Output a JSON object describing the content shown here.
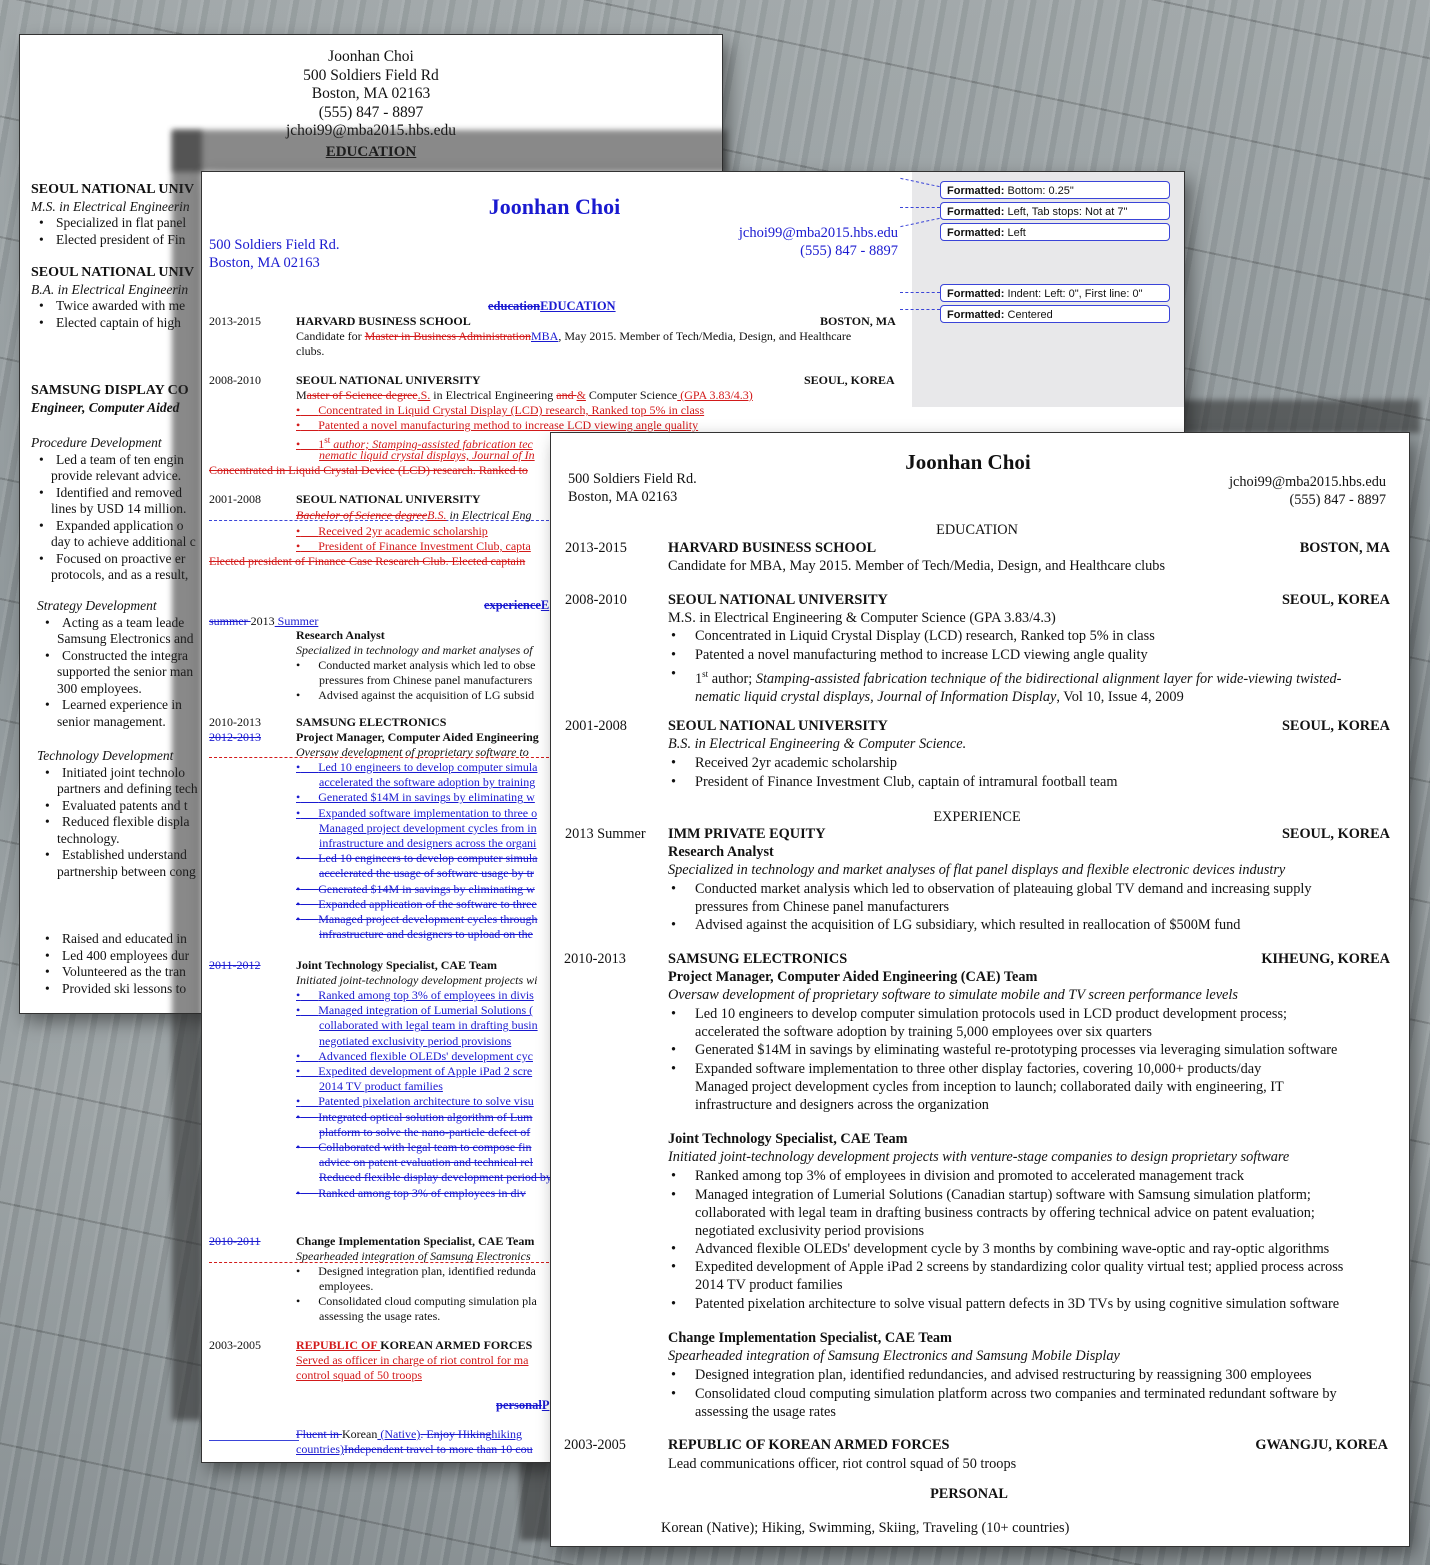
{
  "page1": {
    "header": [
      "Joonhan Choi",
      "500 Soldiers Field Rd",
      "Boston, MA 02163",
      "(555) 847 - 8897",
      "jchoi99@mba2015.hbs.edu"
    ],
    "section_education": "EDUCATION",
    "snu1_name": "SEOUL NATIONAL UNIV",
    "snu1_degree": "M.S. in Electrical Engineerin",
    "snu1_b1": "Specialized in flat panel",
    "snu1_b2": "Elected president of Fin",
    "snu2_name": "SEOUL NATIONAL UNIV",
    "snu2_degree": "B.A. in Electrical Engineerin",
    "snu2_b1": "Twice awarded with me",
    "snu2_b2": "Elected captain of high",
    "sam_name": "SAMSUNG DISPLAY CO",
    "sam_role": "Engineer, Computer Aided",
    "proc_head": "Procedure Development",
    "proc_lines": [
      "Led a team of ten engin",
      "provide relevant advice.",
      "Identified and removed",
      "lines by USD 14 million.",
      "Expanded application o",
      "day to achieve additional c",
      "Focused on proactive er",
      "protocols, and as a result,"
    ],
    "strat_head": "Strategy Development",
    "strat_lines": [
      "Acting as a team leade",
      "Samsung Electronics and",
      "Constructed the integra",
      "supported the senior man",
      "300 employees.",
      "Learned experience in",
      "senior management."
    ],
    "tech_head": "Technology Development",
    "tech_lines": [
      "Initiated joint technolo",
      "partners and defining tech",
      "Evaluated patents and t",
      "Reduced flexible displa",
      "technology.",
      "Established understand",
      "partnership between cong"
    ],
    "pers_lines": [
      "Raised and educated in",
      "Led 400 employees dur",
      "Volunteered as the tran",
      "Provided ski lessons to"
    ]
  },
  "page2": {
    "name": "Joonhan Choi",
    "addr1": "500 Soldiers Field Rd.",
    "addr2": "Boston, MA 02163",
    "email": "jchoi99@mba2015.hbs.edu",
    "phone": "(555) 847 - 8897",
    "balloons": [
      {
        "k": "Formatted:",
        "v": " Bottom:  0.25\""
      },
      {
        "k": "Formatted:",
        "v": " Left, Tab stops: Not at  7\""
      },
      {
        "k": "Formatted:",
        "v": " Left"
      },
      {
        "k": "Formatted:",
        "v": " Indent: Left:  0\", First line:  0\""
      },
      {
        "k": "Formatted:",
        "v": " Centered"
      }
    ],
    "edu_del": "education",
    "edu_ins": "EDUCATION",
    "hbs_years": "2013-2015",
    "hbs_name": "HARVARD BUSINESS SCHOOL",
    "hbs_loc": "BOSTON, MA",
    "hbs_l1a": "Candidate for ",
    "hbs_l1_del": "Master in Business Administration",
    "hbs_l1_ins": "MBA",
    "hbs_l1b": ", May 2015. Member of Tech/Media, Design, and Healthcare",
    "hbs_l2": "clubs.",
    "snu_years": "2008-2010",
    "snu_name": "SEOUL NATIONAL UNIVERSITY",
    "snu_loc": "SEOUL, KOREA",
    "snu_l1a": "M",
    "snu_l1_del1": "aster of Science degree",
    "snu_l1_ins1": ".S.",
    "snu_l1b": " in Electrical Engineering ",
    "snu_l1_del2": "and ",
    "snu_l1_ins2": "&",
    "snu_l1c": " Computer Science",
    "snu_l1_ins3": " (GPA 3.83/4.3)",
    "snu_b1": "Concentrated in Liquid Crystal Display (LCD) research, Ranked top 5% in class",
    "snu_b2": "Patented a novel manufacturing method to increase LCD viewing angle quality",
    "snu_b3a": "1",
    "snu_b3sup": "st",
    "snu_b3b": " author; Stamping-assisted fabrication tec",
    "snu_b3c": "nematic liquid crystal displays, Journal of In",
    "snu_del_line": "Concentrated in Liquid Crystal Device (LCD) research. Ranked to",
    "snu2_years": "2001-2008",
    "snu2_name": "SEOUL NATIONAL UNIVERSITY",
    "snu2_l1_del": "Bachelor of Science degree",
    "snu2_l1_ins": "B.S.",
    "snu2_l1b": " in Electrical Eng",
    "snu2_b1": "Received 2yr academic scholarship",
    "snu2_b2": "President of Finance Investment Club, capta",
    "snu2_del_line": "Elected president of Finance Case Research Club. Elected captain",
    "exp_del": "experience",
    "exp_ins": "E",
    "imm_years_del": "summer ",
    "imm_years": "2013",
    "imm_years_ins": " Summer",
    "imm_role": "Research Analyst",
    "imm_desc": "Specialized in technology and market analyses of",
    "imm_b1": "Conducted market analysis which led to obse",
    "imm_b1b": "pressures from Chinese panel manufacturers",
    "imm_b2": "Advised against the acquisition of LG subsid",
    "sam_years": "2010-2013",
    "sam_years_del": "2012-2013",
    "sam_name": "SAMSUNG ELECTRONICS",
    "sam_role": "Project Manager, Computer Aided Engineering",
    "sam_desc": "Oversaw development of proprietary software to",
    "sam_lines": [
      {
        "t": "Led 10 engineers to develop computer simula",
        "c": "blue ul",
        "b": true
      },
      {
        "t": "accelerated the software adoption by training",
        "c": "blue ul",
        "b": false
      },
      {
        "t": "Generated $14M in savings by eliminating w",
        "c": "blue ul",
        "b": true
      },
      {
        "t": "Expanded software implementation to three o",
        "c": "blue ul",
        "b": true
      },
      {
        "t": "Managed project development cycles from in",
        "c": "blue ul",
        "b": false
      },
      {
        "t": "infrastructure and designers across the organi",
        "c": "blue ul",
        "b": false
      },
      {
        "t": "Led 10 engineers to develop computer simula",
        "c": "blue st",
        "b": true
      },
      {
        "t": "accelerated the usage of software usage by tr",
        "c": "blue st",
        "b": false
      },
      {
        "t": "Generated $14M in savings by eliminating w",
        "c": "blue st",
        "b": true
      },
      {
        "t": "Expanded application of the software to three",
        "c": "blue st",
        "b": true
      },
      {
        "t": "Managed project development cycles through",
        "c": "blue st",
        "b": true
      },
      {
        "t": "infrastructure and designers to upload on the",
        "c": "blue st",
        "b": false
      }
    ],
    "jts_years_del": "2011-2012",
    "jts_role": "Joint Technology Specialist, CAE Team",
    "jts_desc": "Initiated joint-technology development projects wi",
    "jts_lines": [
      {
        "t": "Ranked among top 3% of employees in divis",
        "c": "blue ul",
        "b": true
      },
      {
        "t": "Managed integration of Lumerial Solutions (",
        "c": "blue ul",
        "b": true
      },
      {
        "t": "collaborated with legal team in drafting busin",
        "c": "blue ul",
        "b": false
      },
      {
        "t": "negotiated exclusivity period provisions",
        "c": "blue ul",
        "b": false
      },
      {
        "t": "Advanced flexible OLEDs' development cyc",
        "c": "blue ul",
        "b": true
      },
      {
        "t": "Expedited development of Apple iPad 2 scre",
        "c": "blue ul",
        "b": true
      },
      {
        "t": "2014 TV product families",
        "c": "blue ul",
        "b": false
      },
      {
        "t": "Patented pixelation architecture to solve visu",
        "c": "blue ul",
        "b": true
      },
      {
        "t": "Integrated optical solution algorithm of Lum",
        "c": "blue st",
        "b": true
      },
      {
        "t": "platform to solve the nano-particle defect of",
        "c": "blue st",
        "b": false
      },
      {
        "t": "Collaborated with legal team to compose fin",
        "c": "blue st",
        "b": true
      },
      {
        "t": "advice on patent evaluation and technical rel",
        "c": "blue st",
        "b": false
      },
      {
        "t": "Reduced flexible display development period by",
        "c": "blue st",
        "b": false
      },
      {
        "t": "Ranked among top 3% of employees in div",
        "c": "blue st",
        "b": true
      }
    ],
    "cis_years_del": "2010-2011",
    "cis_role": "Change Implementation Specialist, CAE Team",
    "cis_desc": "Spearheaded integration of Samsung Electronics",
    "cis_b1": "Designed integration plan, identified redunda",
    "cis_b1b": "employees.",
    "cis_b2": "Consolidated cloud computing simulation pla",
    "cis_b2b": "assessing the usage rates.",
    "rok_years": "2003-2005",
    "rok_ins": "REPUBLIC OF ",
    "rok_name": "KOREAN ARMED FORCES",
    "rok_l1": "Served as officer in charge of riot control for ma",
    "rok_l2": "control squad of 50 troops",
    "pers_del": "personal",
    "pers_ins": "P",
    "pers_l1_del1": "Fluent in ",
    "pers_l1a": "Korean",
    "pers_l1_ins": " (Native)",
    "pers_l1_del2": ". Enjoy ",
    "pers_l1_del3": "Hiking",
    "pers_l1_ins2": "hiking",
    "pers_l2_ins": "countries)",
    "pers_l2_del": "Independent travel to more than 10 cou"
  },
  "page3": {
    "name": "Joonhan Choi",
    "addr1": "500 Soldiers Field Rd.",
    "addr2": "Boston, MA 02163",
    "email": "jchoi99@mba2015.hbs.edu",
    "phone": "(555) 847 - 8897",
    "education": "EDUCATION",
    "hbs": {
      "years": "2013-2015",
      "name": "HARVARD BUSINESS SCHOOL",
      "loc": "BOSTON, MA",
      "l1": "Candidate for MBA, May 2015. Member of Tech/Media, Design, and Healthcare clubs"
    },
    "snu": {
      "years": "2008-2010",
      "name": "SEOUL NATIONAL UNIVERSITY",
      "loc": "SEOUL, KOREA",
      "l1": "M.S. in Electrical Engineering & Computer Science (GPA 3.83/4.3)",
      "b1": "Concentrated in Liquid Crystal Display (LCD) research, Ranked top 5% in class",
      "b2": "Patented a novel manufacturing method to increase LCD viewing angle quality",
      "b3a": "1",
      "b3sup": "st",
      "b3b": " author; ",
      "b3i": "Stamping-assisted fabrication technique of the bidirectional alignment layer for wide-viewing twisted-",
      "b3c": "nematic liquid crystal displays, Journal of Information Display",
      "b3d": ", Vol 10, Issue 4, 2009"
    },
    "snu2": {
      "years": "2001-2008",
      "name": "SEOUL NATIONAL UNIVERSITY",
      "loc": "SEOUL, KOREA",
      "l1": "B.S. in Electrical Engineering & Computer Science.",
      "b1": "Received 2yr academic scholarship",
      "b2": "President of Finance Investment Club, captain of intramural football team"
    },
    "experience": "EXPERIENCE",
    "imm": {
      "years": "2013 Summer",
      "name": "IMM PRIVATE EQUITY",
      "loc": "SEOUL, KOREA",
      "role": "Research Analyst",
      "desc": "Specialized in technology and market analyses of flat panel displays and flexible electronic devices industry",
      "b1": "Conducted market analysis which led to observation of plateauing global TV demand and increasing supply",
      "b1b": "pressures from Chinese panel manufacturers",
      "b2": "Advised against the acquisition of LG subsidiary, which resulted in reallocation of $500M fund"
    },
    "sam": {
      "years": "2010-2013",
      "name": "SAMSUNG ELECTRONICS",
      "loc": "KIHEUNG, KOREA",
      "role": "Project Manager, Computer Aided Engineering (CAE) Team",
      "desc": "Oversaw development of proprietary software to simulate mobile and TV screen performance levels",
      "b1": "Led 10 engineers to develop computer simulation protocols used in LCD product development process;",
      "b1b": "accelerated the software adoption by training 5,000 employees over six quarters",
      "b2": "Generated $14M in savings by eliminating wasteful re-prototyping processes via leveraging simulation software",
      "b3": "Expanded software implementation to three other display factories, covering 10,000+ products/day",
      "b3b": "Managed project development cycles from inception to launch; collaborated daily with engineering, IT",
      "b3c": "infrastructure and designers across the organization"
    },
    "jts": {
      "role": "Joint Technology Specialist, CAE Team",
      "desc": "Initiated joint-technology development projects with venture-stage companies to design proprietary software",
      "b1": "Ranked among top 3% of employees in division and promoted to accelerated management track",
      "b2": "Managed integration of Lumerial Solutions (Canadian startup) software with Samsung simulation platform;",
      "b2b": "collaborated with legal team in drafting business contracts by offering technical advice on patent evaluation;",
      "b2c": "negotiated exclusivity period provisions",
      "b3": "Advanced flexible OLEDs' development cycle by 3 months by combining wave-optic and ray-optic algorithms",
      "b4": "Expedited development of Apple iPad 2 screens by standardizing color quality virtual test; applied process across",
      "b4b": "2014 TV product families",
      "b5": "Patented pixelation architecture to solve visual pattern defects in 3D TVs by using cognitive simulation software"
    },
    "cis": {
      "role": "Change Implementation Specialist, CAE Team",
      "desc": "Spearheaded integration of Samsung Electronics and Samsung Mobile Display",
      "b1": "Designed integration plan, identified redundancies, and advised restructuring by reassigning 300 employees",
      "b2": "Consolidated cloud computing simulation platform across two companies and terminated redundant software by",
      "b2b": "assessing the usage rates"
    },
    "rok": {
      "years": "2003-2005",
      "name": "REPUBLIC OF KOREAN ARMED FORCES",
      "loc": "GWANGJU, KOREA",
      "l1": "Lead communications officer, riot control squad of 50 troops"
    },
    "personal": "PERSONAL",
    "pers_l1": "Korean (Native); Hiking, Swimming, Skiing, Traveling (10+ countries)",
    "bullet": "•"
  }
}
